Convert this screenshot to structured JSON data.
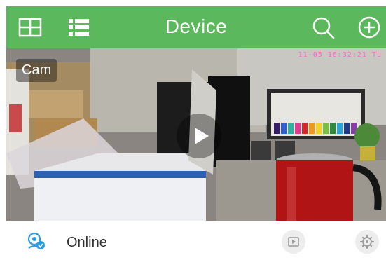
{
  "header": {
    "title": "Device",
    "background_color": "#5cb85c",
    "left_icons": [
      "grid-view-icon",
      "list-view-icon"
    ],
    "right_icons": [
      "search-icon",
      "add-icon"
    ]
  },
  "device": {
    "name": "Cam",
    "timestamp": "11-05 16:32:21 Tu",
    "status": "Online",
    "status_icon": "camera-online-icon",
    "action_icons": [
      "playback-icon",
      "settings-icon"
    ]
  }
}
